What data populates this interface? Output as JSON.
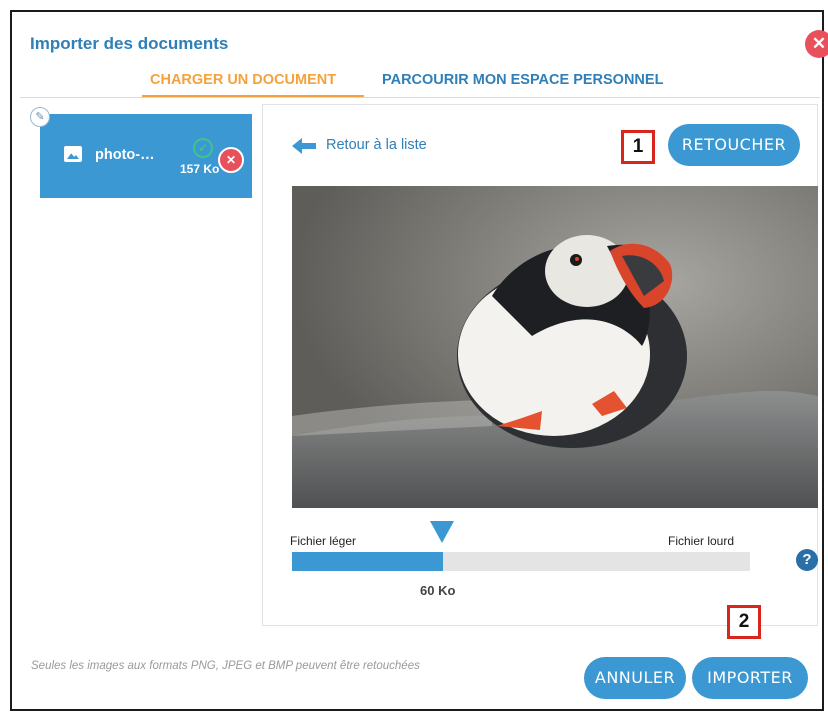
{
  "dialog": {
    "title": "Importer des documents",
    "close_icon": "close-icon",
    "accent_color": "#3b98d2",
    "active_tab_color": "#f3a23c"
  },
  "tabs": [
    {
      "label": "CHARGER UN DOCUMENT",
      "active": true
    },
    {
      "label": "PARCOURIR MON ESPACE PERSONNEL",
      "active": false
    }
  ],
  "file": {
    "name": "photo-…",
    "size": "157 Ko",
    "status_icon": "check-circle-icon",
    "remove_icon": "remove-icon",
    "edit_icon": "pencil-icon"
  },
  "preview": {
    "back_label": "Retour à la liste",
    "retouch_button": "RETOUCHER",
    "callout_1": "1",
    "callout_2": "2"
  },
  "compression": {
    "light_label": "Fichier léger",
    "heavy_label": "Fichier lourd",
    "value_label": "60 Ko",
    "level": 0.33
  },
  "footer": {
    "note": "Seules les images aux formats PNG, JPEG et BMP peuvent être retouchées",
    "cancel_label": "ANNULER",
    "import_label": "IMPORTER"
  }
}
